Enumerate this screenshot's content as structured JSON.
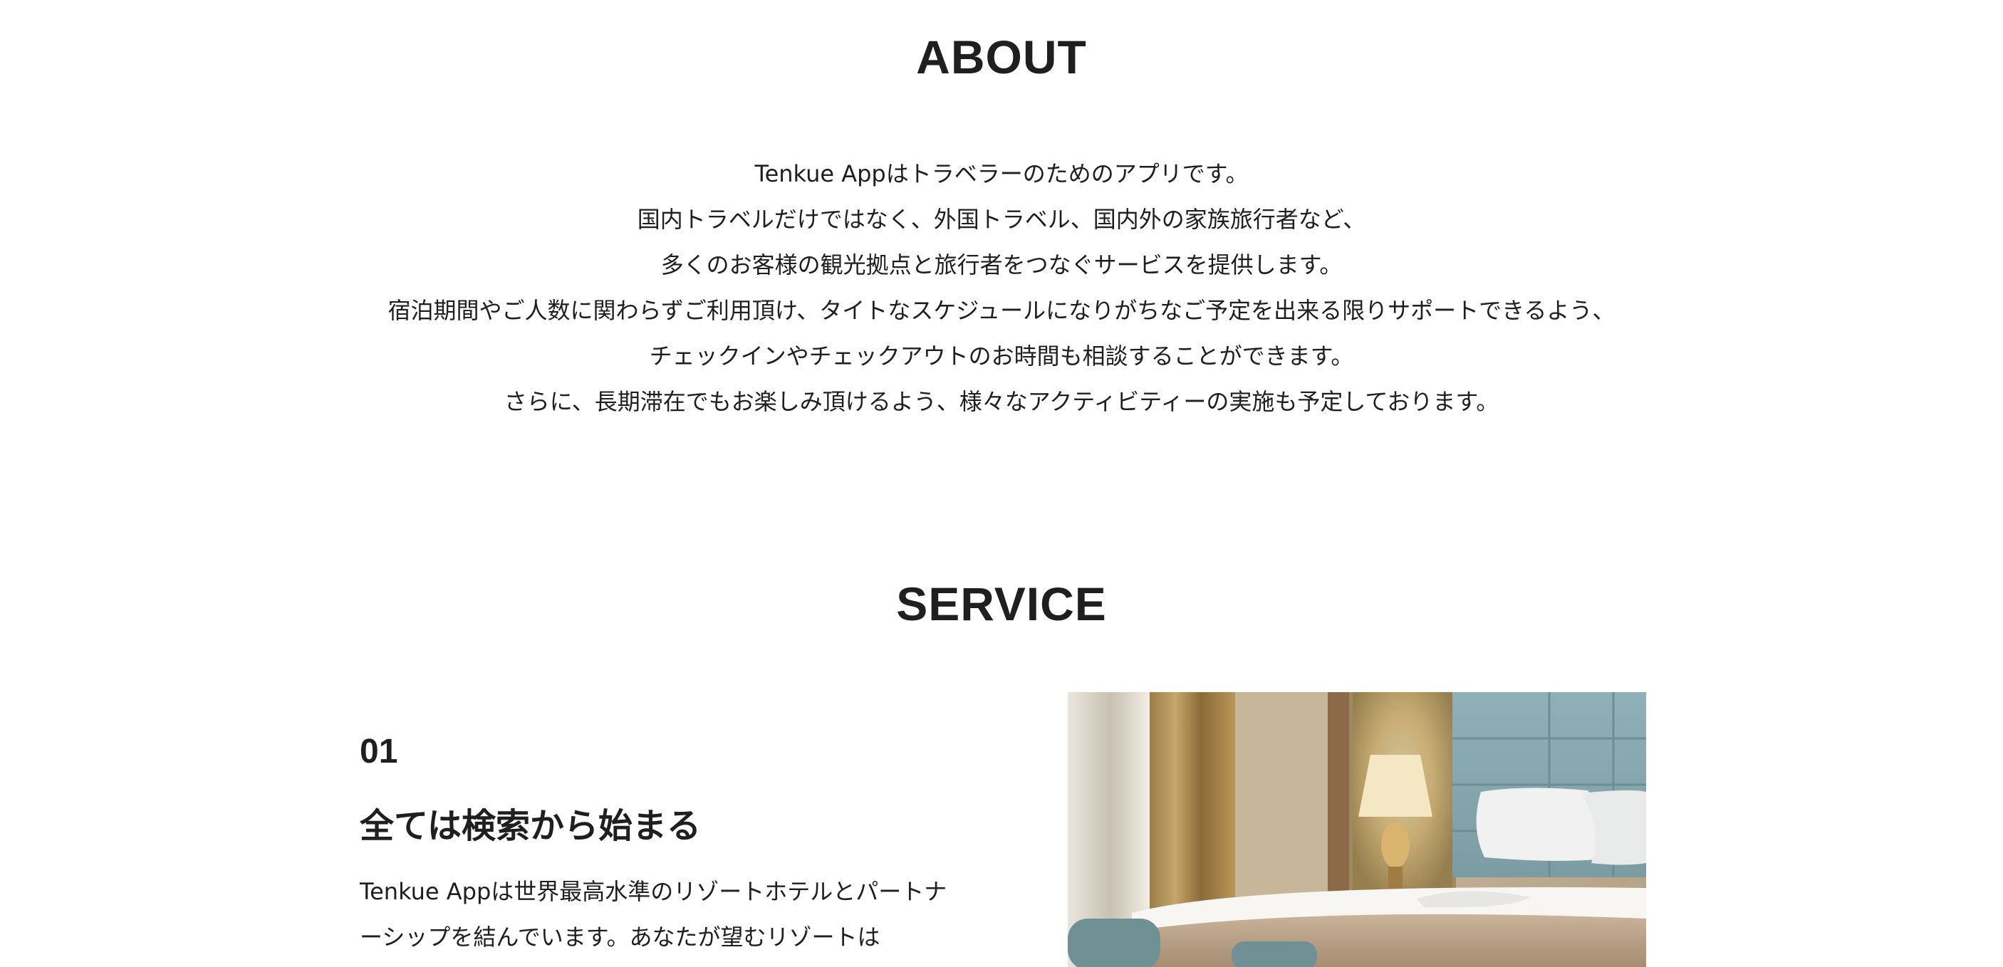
{
  "about": {
    "title": "ABOUT",
    "lines": [
      "Tenkue Appはトラベラーのためのアプリです。",
      "国内トラベルだけではなく、外国トラベル、国内外の家族旅行者など、",
      "多くのお客様の観光拠点と旅行者をつなぐサービスを提供します。",
      "宿泊期間やご人数に関わらずご利用頂け、タイトなスケジュールになりがちなご予定を出来る限りサポートできるよう、",
      "チェックインやチェックアウトのお時間も相談することができます。",
      "さらに、長期滞在でもお楽しみ頂けるよう、様々なアクティビティーの実施も予定しております。"
    ]
  },
  "service": {
    "title": "SERVICE",
    "items": [
      {
        "number": "01",
        "heading": "全ては検索から始まる",
        "lines": [
          "Tenkue Appは世界最高水準のリゾートホテルとパートナ",
          "ーシップを結んでいます。あなたが望むリゾートは"
        ],
        "image": "hotel-room-photo"
      }
    ]
  },
  "colors": {
    "text": "#1f1f1f",
    "background": "#ffffff"
  }
}
